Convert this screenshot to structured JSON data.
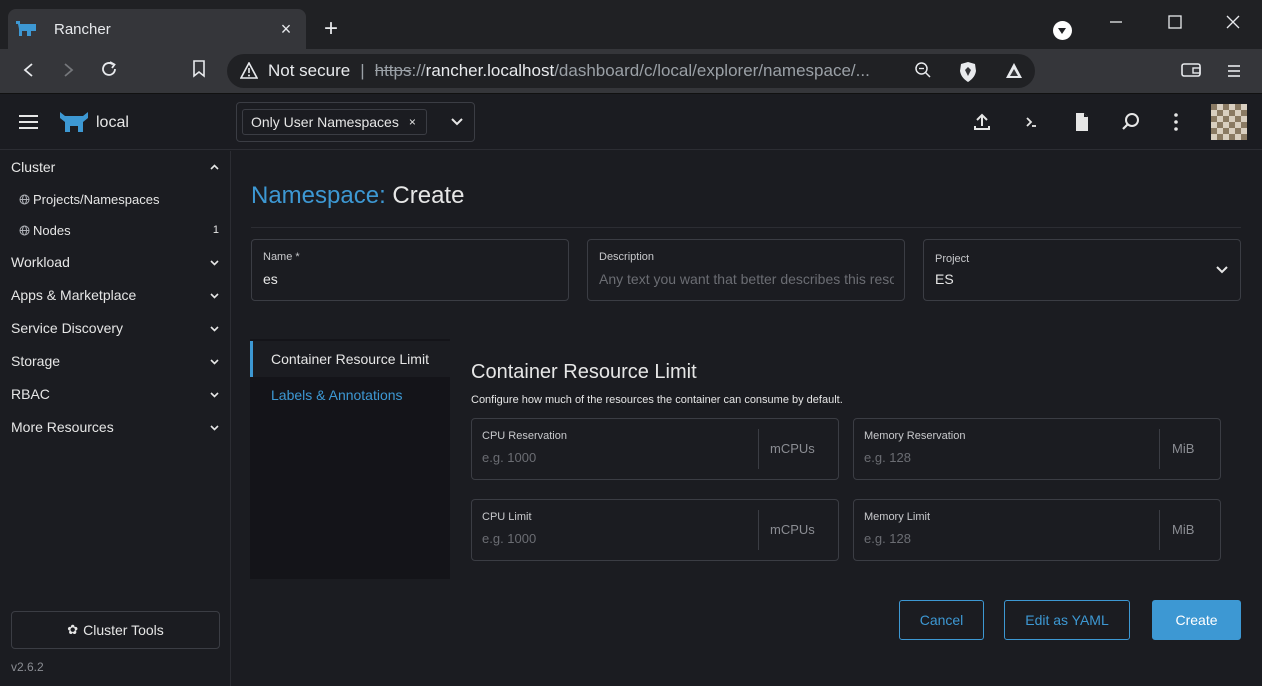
{
  "browser": {
    "tab_title": "Rancher",
    "tab_close": "×",
    "new_tab": "+",
    "security_label": "Not secure",
    "separator": "|",
    "url_scheme": "https",
    "url_sep": "://",
    "url_host": "rancher.localhost",
    "url_path": "/dashboard/c/local/explorer/namespace/..."
  },
  "header": {
    "cluster_name": "local",
    "namespace_filter_chip": "Only User Namespaces",
    "chip_remove": "×"
  },
  "sidebar": {
    "groups": [
      {
        "label": "Cluster"
      },
      {
        "label": "Workload"
      },
      {
        "label": "Apps & Marketplace"
      },
      {
        "label": "Service Discovery"
      },
      {
        "label": "Storage"
      },
      {
        "label": "RBAC"
      },
      {
        "label": "More Resources"
      }
    ],
    "cluster_items": [
      {
        "label": "Projects/Namespaces",
        "count": ""
      },
      {
        "label": "Nodes",
        "count": "1"
      }
    ],
    "cluster_tools": "Cluster Tools",
    "version": "v2.6.2"
  },
  "page": {
    "breadcrumb": "Namespace:",
    "title": "Create"
  },
  "form": {
    "name": {
      "label": "Name",
      "required_mark": "*",
      "value": "es"
    },
    "description": {
      "label": "Description",
      "placeholder": "Any text you want that better describes this reso"
    },
    "project": {
      "label": "Project",
      "value": "ES"
    }
  },
  "tabs": [
    {
      "label": "Container Resource Limit",
      "active": true
    },
    {
      "label": "Labels & Annotations",
      "active": false
    }
  ],
  "limits": {
    "title": "Container Resource Limit",
    "description": "Configure how much of the resources the container can consume by default.",
    "cpu_reservation": {
      "label": "CPU Reservation",
      "placeholder": "e.g. 1000",
      "unit": "mCPUs"
    },
    "memory_reservation": {
      "label": "Memory Reservation",
      "placeholder": "e.g. 128",
      "unit": "MiB"
    },
    "cpu_limit": {
      "label": "CPU Limit",
      "placeholder": "e.g. 1000",
      "unit": "mCPUs"
    },
    "memory_limit": {
      "label": "Memory Limit",
      "placeholder": "e.g. 128",
      "unit": "MiB"
    }
  },
  "actions": {
    "cancel": "Cancel",
    "edit_yaml": "Edit as YAML",
    "create": "Create"
  },
  "colors": {
    "accent": "#3d98d3",
    "background": "#1b1c21"
  }
}
